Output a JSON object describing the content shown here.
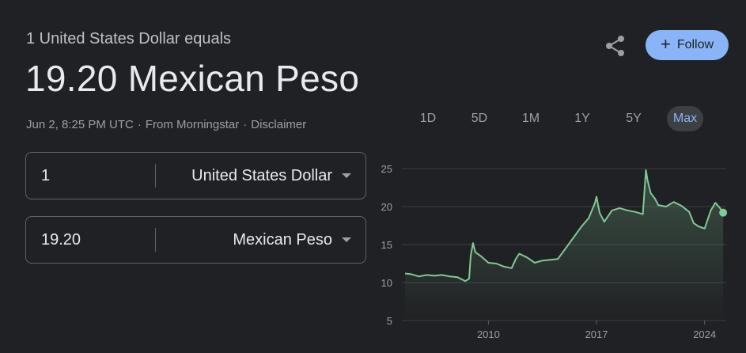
{
  "header": {
    "subtitle": "1 United States Dollar equals",
    "headline": "19.20 Mexican Peso",
    "timestamp": "Jun 2, 8:25 PM UTC",
    "source": "From Morningstar",
    "disclaimer": "Disclaimer"
  },
  "actions": {
    "share_icon": "share-icon",
    "follow_label": "Follow",
    "follow_icon": "+"
  },
  "converter": {
    "from": {
      "value": "1",
      "currency": "United States Dollar"
    },
    "to": {
      "value": "19.20",
      "currency": "Mexican Peso"
    }
  },
  "range_tabs": [
    {
      "label": "1D",
      "active": false
    },
    {
      "label": "5D",
      "active": false
    },
    {
      "label": "1M",
      "active": false
    },
    {
      "label": "1Y",
      "active": false
    },
    {
      "label": "5Y",
      "active": false
    },
    {
      "label": "Max",
      "active": true
    }
  ],
  "colors": {
    "line": "#81c995",
    "accent": "#8ab4f8",
    "background": "#202124"
  },
  "chart_data": {
    "type": "area",
    "title": "",
    "xlabel": "",
    "ylabel": "",
    "ylim": [
      5,
      25
    ],
    "xlim": [
      2004.6,
      2025.4
    ],
    "yticks": [
      25,
      20,
      15,
      10,
      5
    ],
    "xticks": [
      2010,
      2017,
      2024
    ],
    "grid": true,
    "series": [
      {
        "x": [
          2004.6,
          2005.0,
          2005.5,
          2006.0,
          2006.5,
          2007.0,
          2007.5,
          2008.0,
          2008.5,
          2008.75,
          2008.85,
          2009.0,
          2009.15,
          2009.5,
          2010.0,
          2010.5,
          2011.0,
          2011.5,
          2011.8,
          2012.0,
          2012.5,
          2013.0,
          2013.5,
          2014.0,
          2014.5,
          2015.0,
          2015.5,
          2016.0,
          2016.5,
          2016.9,
          2017.0,
          2017.2,
          2017.5,
          2018.0,
          2018.5,
          2019.0,
          2019.5,
          2020.0,
          2020.2,
          2020.3,
          2020.5,
          2020.8,
          2021.0,
          2021.5,
          2022.0,
          2022.5,
          2023.0,
          2023.3,
          2023.6,
          2024.0,
          2024.4,
          2024.7,
          2025.0,
          2025.2
        ],
        "y": [
          11.2,
          11.1,
          10.8,
          11.0,
          10.9,
          11.0,
          10.8,
          10.7,
          10.2,
          10.5,
          13.5,
          15.2,
          14.0,
          13.5,
          12.6,
          12.5,
          12.1,
          11.9,
          13.2,
          13.8,
          13.3,
          12.6,
          12.9,
          13.0,
          13.1,
          14.5,
          15.9,
          17.3,
          18.5,
          20.5,
          21.3,
          19.2,
          18.0,
          19.5,
          19.8,
          19.5,
          19.3,
          19.0,
          24.8,
          23.5,
          21.8,
          21.0,
          20.2,
          20.0,
          20.6,
          20.1,
          19.3,
          17.8,
          17.4,
          17.1,
          19.5,
          20.5,
          19.8,
          19.2
        ]
      }
    ],
    "end_point": 19.2
  }
}
